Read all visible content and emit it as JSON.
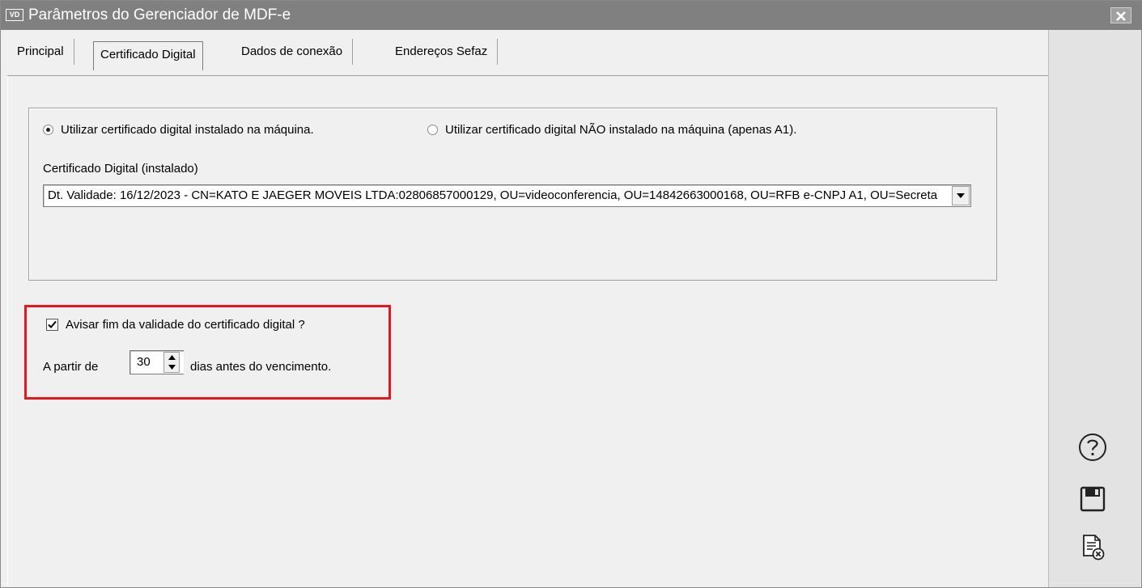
{
  "window": {
    "title": "Parâmetros do Gerenciador de MDF-e",
    "app_icon_text": "VD",
    "close_label": "x"
  },
  "tabs": [
    {
      "label": "Principal",
      "active": false
    },
    {
      "label": "Certificado Digital",
      "active": true
    },
    {
      "label": "Dados de conexão",
      "active": false
    },
    {
      "label": "Endereços Sefaz",
      "active": false
    }
  ],
  "certificate": {
    "radio_installed": "Utilizar certificado digital instalado na máquina.",
    "radio_installed_checked": true,
    "radio_not_installed": "Utilizar certificado digital NÃO instalado na máquina (apenas A1).",
    "radio_not_installed_checked": false,
    "combo_label": "Certificado Digital (instalado)",
    "combo_value": "Dt. Validade: 16/12/2023 - CN=KATO E JAEGER MOVEIS LTDA:02806857000129, OU=videoconferencia, OU=14842663000168, OU=RFB e-CNPJ A1, OU=Secretaria da Receita Federal do Brasil - RFB"
  },
  "expiry_warning": {
    "checkbox_label": "Avisar fim da validade do certificado digital ?",
    "checked": true,
    "prefix_label": "A partir de",
    "days_value": "30",
    "suffix_label": "dias antes do vencimento."
  },
  "toolbar": {
    "help_icon": "help-icon",
    "save_icon": "save-icon",
    "cancel_icon": "cancel-document-icon"
  },
  "colors": {
    "titlebar": "#808080",
    "highlight": "#e8171f",
    "background": "#f0f0f0"
  }
}
